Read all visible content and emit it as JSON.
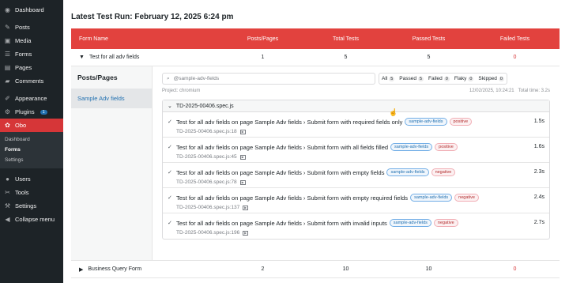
{
  "sidebar": {
    "items": [
      {
        "label": "Dashboard",
        "icon": "dashboard-icon",
        "glyph": "◉"
      },
      {
        "label": "Posts",
        "icon": "pin-icon",
        "glyph": "✎"
      },
      {
        "label": "Media",
        "icon": "media-icon",
        "glyph": "▣"
      },
      {
        "label": "Forms",
        "icon": "forms-icon",
        "glyph": "☰"
      },
      {
        "label": "Pages",
        "icon": "pages-icon",
        "glyph": "▤"
      },
      {
        "label": "Comments",
        "icon": "comments-icon",
        "glyph": "▰"
      },
      {
        "label": "Appearance",
        "icon": "brush-icon",
        "glyph": "✐"
      },
      {
        "label": "Plugins",
        "icon": "plugin-icon",
        "glyph": "⚙",
        "badge": "1"
      },
      {
        "label": "Obo",
        "icon": "gear-icon",
        "glyph": "✿"
      },
      {
        "label": "Users",
        "icon": "users-icon",
        "glyph": "●"
      },
      {
        "label": "Tools",
        "icon": "wrench-icon",
        "glyph": "✂"
      },
      {
        "label": "Settings",
        "icon": "settings-icon",
        "glyph": "⚒"
      },
      {
        "label": "Collapse menu",
        "icon": "collapse-icon",
        "glyph": "◀"
      }
    ],
    "submenu": [
      "Dashboard",
      "Forms",
      "Settings"
    ]
  },
  "main": {
    "title": "Latest Test Run: February 12, 2025 6:24 pm",
    "table": {
      "headers": [
        "Form Name",
        "Posts/Pages",
        "Total Tests",
        "Passed Tests",
        "Failed Tests"
      ],
      "rows": [
        {
          "name": "Test for all adv fields",
          "posts": "1",
          "total": "5",
          "passed": "5",
          "failed": "0"
        },
        {
          "name": "Business Query Form",
          "posts": "2",
          "total": "10",
          "passed": "10",
          "failed": "0"
        }
      ]
    },
    "detail": {
      "left_title": "Posts/Pages",
      "left_item": "Sample Adv fields",
      "search_placeholder": "@sample-adv-fields",
      "filters": [
        {
          "label": "All",
          "count": "5"
        },
        {
          "label": "Passed",
          "count": "5"
        },
        {
          "label": "Failed",
          "count": "0"
        },
        {
          "label": "Flaky",
          "count": "0"
        },
        {
          "label": "Skipped",
          "count": "0"
        }
      ],
      "project": "Project: chromium",
      "timestamp": "12/02/2025, 10:24:21",
      "total_time": "Total time: 3.2s",
      "file": "TD-2025-00406.spec.js",
      "tests": [
        {
          "title": "Test for all adv fields on page Sample Adv fields › Submit form with required fields only",
          "tags": [
            "sample-adv-fields",
            "positive"
          ],
          "loc": "TD-2025-00406.spec.js:18",
          "dur": "1.5s"
        },
        {
          "title": "Test for all adv fields on page Sample Adv fields › Submit form with all fields filled",
          "tags": [
            "sample-adv-fields",
            "positive"
          ],
          "loc": "TD-2025-00406.spec.js:45",
          "dur": "1.6s"
        },
        {
          "title": "Test for all adv fields on page Sample Adv fields › Submit form with empty fields",
          "tags": [
            "sample-adv-fields",
            "negative"
          ],
          "loc": "TD-2025-00406.spec.js:78",
          "dur": "2.3s"
        },
        {
          "title": "Test for all adv fields on page Sample Adv fields › Submit form with empty required fields",
          "tags": [
            "sample-adv-fields",
            "negative"
          ],
          "loc": "TD-2025-00406.spec.js:137",
          "dur": "2.4s"
        },
        {
          "title": "Test for all adv fields on page Sample Adv fields › Submit form with invalid inputs",
          "tags": [
            "sample-adv-fields",
            "negative"
          ],
          "loc": "TD-2025-00406.spec.js:196",
          "dur": "2.7s"
        }
      ]
    }
  }
}
